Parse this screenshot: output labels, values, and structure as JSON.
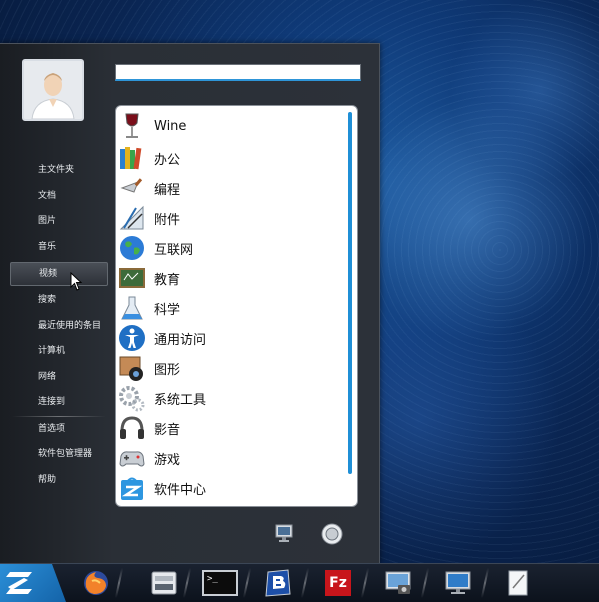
{
  "colors": {
    "accent": "#1f8fd6",
    "menu_bg": "#2a2f36",
    "taskbar_bg": "#0c121c"
  },
  "start_menu": {
    "search": {
      "value": "",
      "placeholder": ""
    },
    "left_items": [
      {
        "label": "主文件夹"
      },
      {
        "label": "文档"
      },
      {
        "label": "图片"
      },
      {
        "label": "音乐"
      },
      {
        "label": "视频"
      },
      {
        "label": "搜索"
      },
      {
        "label": "最近使用的条目"
      },
      {
        "label": "计算机"
      },
      {
        "label": "网络"
      },
      {
        "label": "连接到"
      },
      {
        "label": "首选项"
      },
      {
        "label": "软件包管理器"
      },
      {
        "label": "帮助"
      }
    ],
    "apps": [
      {
        "label": "Wine",
        "icon": "wine-glass-icon"
      },
      {
        "label": "办公",
        "icon": "office-books-icon"
      },
      {
        "label": "编程",
        "icon": "programming-trowel-icon"
      },
      {
        "label": "附件",
        "icon": "accessories-drafting-icon"
      },
      {
        "label": "互联网",
        "icon": "internet-globe-icon"
      },
      {
        "label": "教育",
        "icon": "education-chalkboard-icon"
      },
      {
        "label": "科学",
        "icon": "science-flask-icon"
      },
      {
        "label": "通用访问",
        "icon": "accessibility-icon"
      },
      {
        "label": "图形",
        "icon": "graphics-icon"
      },
      {
        "label": "系统工具",
        "icon": "system-tools-gears-icon"
      },
      {
        "label": "影音",
        "icon": "multimedia-headphones-icon"
      },
      {
        "label": "游戏",
        "icon": "games-controller-icon"
      },
      {
        "label": "软件中心",
        "icon": "software-center-icon"
      }
    ]
  },
  "taskbar": {
    "items": [
      {
        "icon": "zorin-logo-icon"
      },
      {
        "icon": "firefox-icon"
      },
      {
        "icon": "file-manager-icon"
      },
      {
        "icon": "terminal-icon"
      },
      {
        "icon": "bluefish-editor-icon"
      },
      {
        "icon": "filezilla-icon"
      },
      {
        "icon": "screenshot-icon"
      },
      {
        "icon": "display-settings-icon"
      },
      {
        "icon": "text-editor-icon"
      }
    ],
    "terminal_prompt": ">_",
    "filezilla_text": "Fz"
  }
}
